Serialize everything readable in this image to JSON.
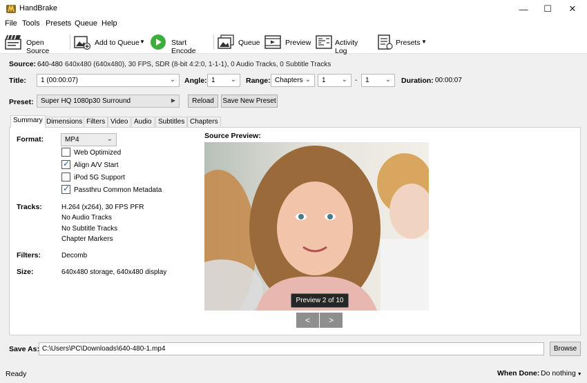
{
  "window": {
    "title": "HandBrake",
    "minimize": "—",
    "maximize": "☐",
    "close": "✕"
  },
  "menu": [
    "File",
    "Tools",
    "Presets",
    "Queue",
    "Help"
  ],
  "toolbar": {
    "open_source": "Open Source",
    "add_to_queue": "Add to Queue",
    "start_encode": "Start Encode",
    "queue": "Queue",
    "preview": "Preview",
    "activity_log": "Activity Log",
    "presets": "Presets"
  },
  "source": {
    "label": "Source:",
    "name": "640-480",
    "details": "640x480 (640x480), 30 FPS, SDR (8-bit 4:2:0, 1-1-1), 0 Audio Tracks, 0 Subtitle Tracks"
  },
  "title_row": {
    "title_label": "Title:",
    "title_value": "1  (00:00:07)",
    "angle_label": "Angle:",
    "angle_value": "1",
    "range_label": "Range:",
    "range_type": "Chapters",
    "range_start": "1",
    "range_dash": "-",
    "range_end": "1",
    "duration_label": "Duration:",
    "duration_value": "00:00:07"
  },
  "preset_row": {
    "label": "Preset:",
    "value": "Super HQ 1080p30 Surround",
    "reload": "Reload",
    "save_new": "Save New Preset"
  },
  "tabs": [
    "Summary",
    "Dimensions",
    "Filters",
    "Video",
    "Audio",
    "Subtitles",
    "Chapters"
  ],
  "summary": {
    "format_label": "Format:",
    "format_value": "MP4",
    "options": [
      {
        "label": "Web Optimized",
        "checked": false
      },
      {
        "label": "Align A/V Start",
        "checked": true
      },
      {
        "label": "iPod 5G Support",
        "checked": false
      },
      {
        "label": "Passthru Common Metadata",
        "checked": true
      }
    ],
    "tracks_label": "Tracks:",
    "tracks": [
      "H.264 (x264), 30 FPS PFR",
      "No Audio Tracks",
      "No Subtitle Tracks",
      "Chapter Markers"
    ],
    "filters_label": "Filters:",
    "filters_value": "Decomb",
    "size_label": "Size:",
    "size_value": "640x480 storage, 640x480 display",
    "source_preview_label": "Source Preview:",
    "preview_badge": "Preview 2 of 10",
    "prev": "<",
    "next": ">"
  },
  "save_as": {
    "label": "Save As:",
    "path": "C:\\Users\\PC\\Downloads\\640-480-1.mp4",
    "browse": "Browse"
  },
  "status": {
    "text": "Ready",
    "when_done_label": "When Done:",
    "when_done_value": "Do nothing"
  },
  "colors": {
    "accent_check": "#1a5fb4",
    "start_encode_green": "#3cae3c"
  }
}
